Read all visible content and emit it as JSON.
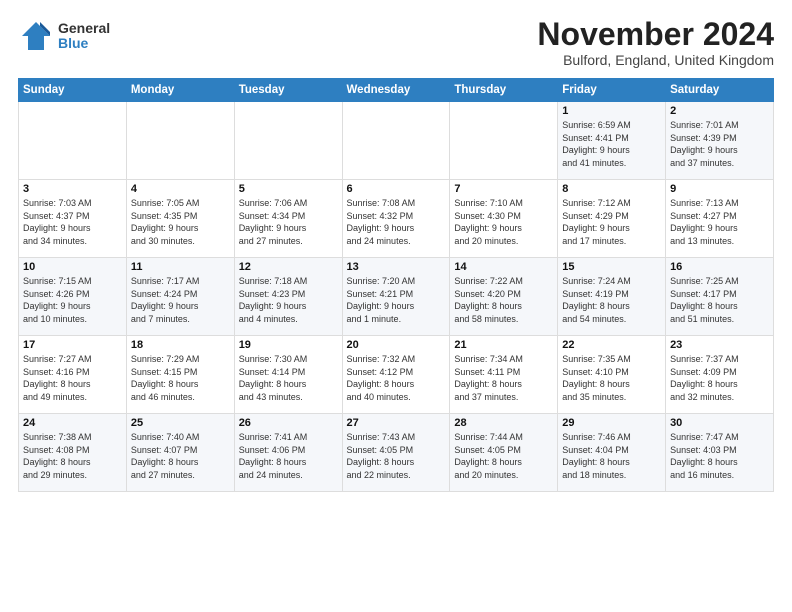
{
  "logo": {
    "general": "General",
    "blue": "Blue"
  },
  "title": "November 2024",
  "location": "Bulford, England, United Kingdom",
  "days_of_week": [
    "Sunday",
    "Monday",
    "Tuesday",
    "Wednesday",
    "Thursday",
    "Friday",
    "Saturday"
  ],
  "weeks": [
    [
      {
        "day": "",
        "info": ""
      },
      {
        "day": "",
        "info": ""
      },
      {
        "day": "",
        "info": ""
      },
      {
        "day": "",
        "info": ""
      },
      {
        "day": "",
        "info": ""
      },
      {
        "day": "1",
        "info": "Sunrise: 6:59 AM\nSunset: 4:41 PM\nDaylight: 9 hours\nand 41 minutes."
      },
      {
        "day": "2",
        "info": "Sunrise: 7:01 AM\nSunset: 4:39 PM\nDaylight: 9 hours\nand 37 minutes."
      }
    ],
    [
      {
        "day": "3",
        "info": "Sunrise: 7:03 AM\nSunset: 4:37 PM\nDaylight: 9 hours\nand 34 minutes."
      },
      {
        "day": "4",
        "info": "Sunrise: 7:05 AM\nSunset: 4:35 PM\nDaylight: 9 hours\nand 30 minutes."
      },
      {
        "day": "5",
        "info": "Sunrise: 7:06 AM\nSunset: 4:34 PM\nDaylight: 9 hours\nand 27 minutes."
      },
      {
        "day": "6",
        "info": "Sunrise: 7:08 AM\nSunset: 4:32 PM\nDaylight: 9 hours\nand 24 minutes."
      },
      {
        "day": "7",
        "info": "Sunrise: 7:10 AM\nSunset: 4:30 PM\nDaylight: 9 hours\nand 20 minutes."
      },
      {
        "day": "8",
        "info": "Sunrise: 7:12 AM\nSunset: 4:29 PM\nDaylight: 9 hours\nand 17 minutes."
      },
      {
        "day": "9",
        "info": "Sunrise: 7:13 AM\nSunset: 4:27 PM\nDaylight: 9 hours\nand 13 minutes."
      }
    ],
    [
      {
        "day": "10",
        "info": "Sunrise: 7:15 AM\nSunset: 4:26 PM\nDaylight: 9 hours\nand 10 minutes."
      },
      {
        "day": "11",
        "info": "Sunrise: 7:17 AM\nSunset: 4:24 PM\nDaylight: 9 hours\nand 7 minutes."
      },
      {
        "day": "12",
        "info": "Sunrise: 7:18 AM\nSunset: 4:23 PM\nDaylight: 9 hours\nand 4 minutes."
      },
      {
        "day": "13",
        "info": "Sunrise: 7:20 AM\nSunset: 4:21 PM\nDaylight: 9 hours\nand 1 minute."
      },
      {
        "day": "14",
        "info": "Sunrise: 7:22 AM\nSunset: 4:20 PM\nDaylight: 8 hours\nand 58 minutes."
      },
      {
        "day": "15",
        "info": "Sunrise: 7:24 AM\nSunset: 4:19 PM\nDaylight: 8 hours\nand 54 minutes."
      },
      {
        "day": "16",
        "info": "Sunrise: 7:25 AM\nSunset: 4:17 PM\nDaylight: 8 hours\nand 51 minutes."
      }
    ],
    [
      {
        "day": "17",
        "info": "Sunrise: 7:27 AM\nSunset: 4:16 PM\nDaylight: 8 hours\nand 49 minutes."
      },
      {
        "day": "18",
        "info": "Sunrise: 7:29 AM\nSunset: 4:15 PM\nDaylight: 8 hours\nand 46 minutes."
      },
      {
        "day": "19",
        "info": "Sunrise: 7:30 AM\nSunset: 4:14 PM\nDaylight: 8 hours\nand 43 minutes."
      },
      {
        "day": "20",
        "info": "Sunrise: 7:32 AM\nSunset: 4:12 PM\nDaylight: 8 hours\nand 40 minutes."
      },
      {
        "day": "21",
        "info": "Sunrise: 7:34 AM\nSunset: 4:11 PM\nDaylight: 8 hours\nand 37 minutes."
      },
      {
        "day": "22",
        "info": "Sunrise: 7:35 AM\nSunset: 4:10 PM\nDaylight: 8 hours\nand 35 minutes."
      },
      {
        "day": "23",
        "info": "Sunrise: 7:37 AM\nSunset: 4:09 PM\nDaylight: 8 hours\nand 32 minutes."
      }
    ],
    [
      {
        "day": "24",
        "info": "Sunrise: 7:38 AM\nSunset: 4:08 PM\nDaylight: 8 hours\nand 29 minutes."
      },
      {
        "day": "25",
        "info": "Sunrise: 7:40 AM\nSunset: 4:07 PM\nDaylight: 8 hours\nand 27 minutes."
      },
      {
        "day": "26",
        "info": "Sunrise: 7:41 AM\nSunset: 4:06 PM\nDaylight: 8 hours\nand 24 minutes."
      },
      {
        "day": "27",
        "info": "Sunrise: 7:43 AM\nSunset: 4:05 PM\nDaylight: 8 hours\nand 22 minutes."
      },
      {
        "day": "28",
        "info": "Sunrise: 7:44 AM\nSunset: 4:05 PM\nDaylight: 8 hours\nand 20 minutes."
      },
      {
        "day": "29",
        "info": "Sunrise: 7:46 AM\nSunset: 4:04 PM\nDaylight: 8 hours\nand 18 minutes."
      },
      {
        "day": "30",
        "info": "Sunrise: 7:47 AM\nSunset: 4:03 PM\nDaylight: 8 hours\nand 16 minutes."
      }
    ]
  ]
}
